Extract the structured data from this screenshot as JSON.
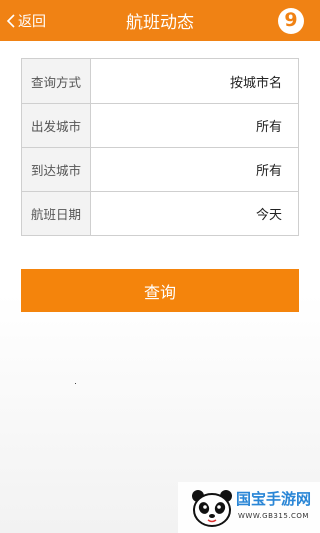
{
  "header": {
    "back_label": "返回",
    "title": "航班动态",
    "logo_glyph": "9",
    "color": "#f08214"
  },
  "form": {
    "rows": [
      {
        "label": "查询方式",
        "value": "按城市名"
      },
      {
        "label": "出发城市",
        "value": "所有"
      },
      {
        "label": "到达城市",
        "value": "所有"
      },
      {
        "label": "航班日期",
        "value": "今天"
      }
    ]
  },
  "query_button": {
    "label": "查询",
    "color": "#f4840c"
  },
  "watermark": {
    "text": "国宝手游网",
    "url": "WWW.GB315.COM"
  },
  "icons": {
    "back": "chevron-left-icon",
    "logo": "app-logo-icon",
    "panda": "panda-icon"
  }
}
